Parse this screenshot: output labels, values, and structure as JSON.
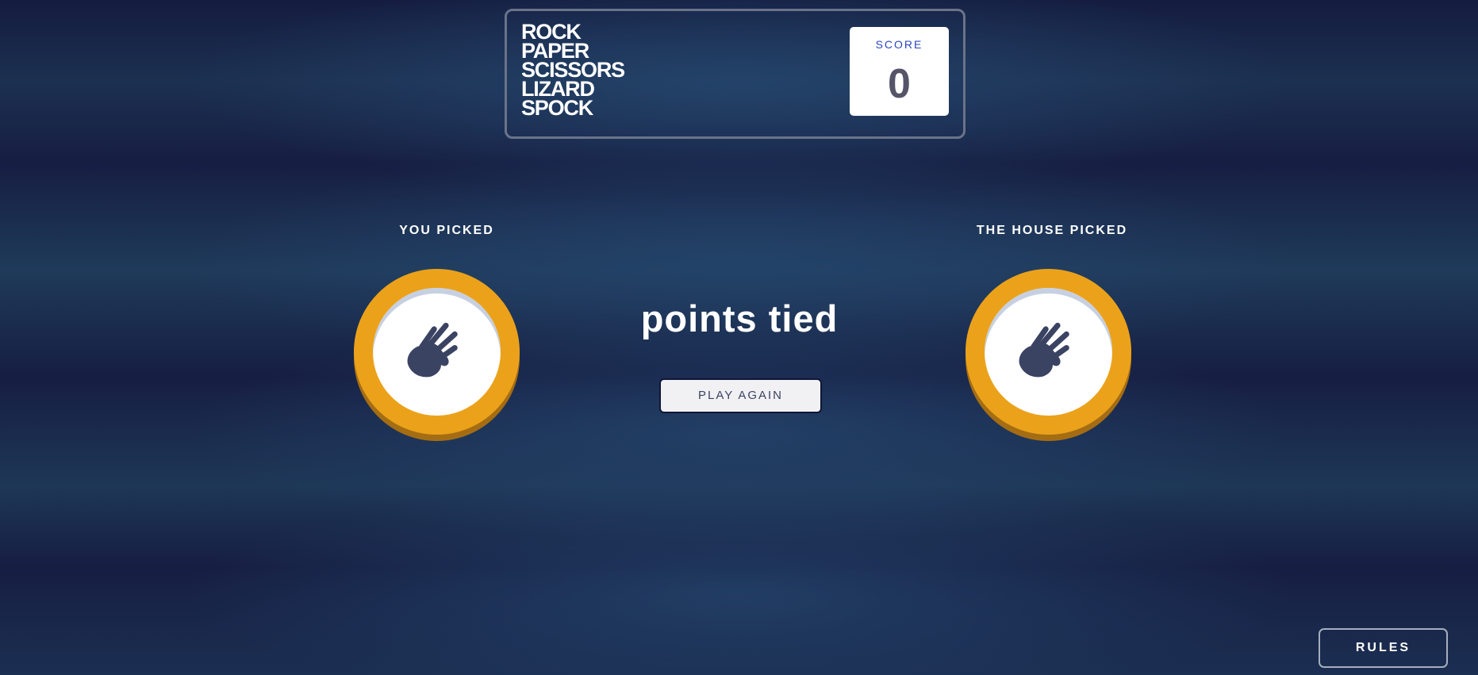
{
  "header": {
    "title_lines": [
      "ROCK",
      "PAPER",
      "SCISSORS",
      "LIZARD",
      "SPOCK"
    ],
    "score_label": "SCORE",
    "score_value": "0"
  },
  "picks": {
    "you_label": "YOU PICKED",
    "house_label": "THE HOUSE PICKED",
    "you_choice_icon": "spock-icon",
    "house_choice_icon": "spock-icon",
    "token_color": "#eba21a",
    "token_shadow_color": "#a46d13"
  },
  "result": {
    "text": "points tied",
    "play_again_label": "PLAY AGAIN"
  },
  "footer": {
    "rules_label": "RULES"
  },
  "colors": {
    "background_dark": "#161e42",
    "background_light": "#1f3a5a",
    "score_label": "#2a46c0",
    "score_value": "#565468",
    "icon": "#3b4363"
  }
}
